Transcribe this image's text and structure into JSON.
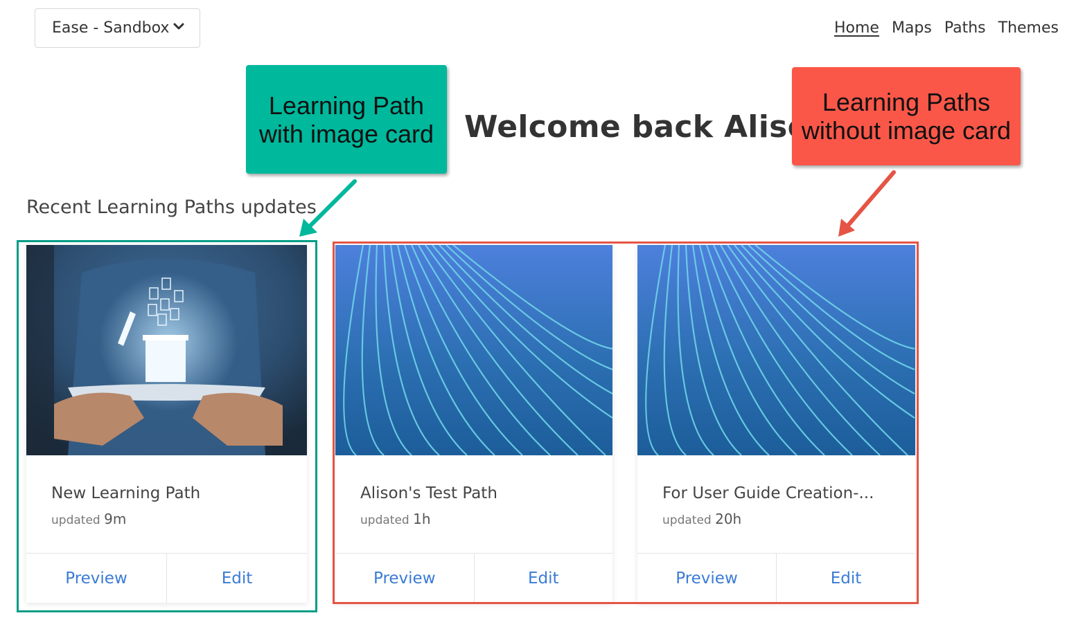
{
  "header": {
    "workspace_label": "Ease - Sandbox",
    "nav": [
      {
        "label": "Home",
        "active": true
      },
      {
        "label": "Maps",
        "active": false
      },
      {
        "label": "Paths",
        "active": false
      },
      {
        "label": "Themes",
        "active": false
      }
    ]
  },
  "welcome_title": "Welcome back Alison",
  "annotations": {
    "with_image": {
      "line1": "Learning Path",
      "line2": "with image card",
      "color": "#00b89c"
    },
    "without_image": {
      "line1": "Learning Paths",
      "line2": "without image card",
      "color": "#fb5749"
    }
  },
  "section_title": "Recent Learning Paths updates",
  "cards": [
    {
      "title": "New Learning Path",
      "updated_prefix": "updated",
      "updated_ago": "9m",
      "preview_label": "Preview",
      "edit_label": "Edit",
      "thumbnail": "tablet-documents-photo"
    },
    {
      "title": "Alison's Test Path",
      "updated_prefix": "updated",
      "updated_ago": "1h",
      "preview_label": "Preview",
      "edit_label": "Edit",
      "thumbnail": "blue-lines-default"
    },
    {
      "title": "For User Guide Creation-...",
      "updated_prefix": "updated",
      "updated_ago": "20h",
      "preview_label": "Preview",
      "edit_label": "Edit",
      "thumbnail": "blue-lines-default"
    }
  ],
  "colors": {
    "link": "#3a7bd5",
    "teal_frame": "#009d86",
    "red_frame": "#e55444"
  }
}
